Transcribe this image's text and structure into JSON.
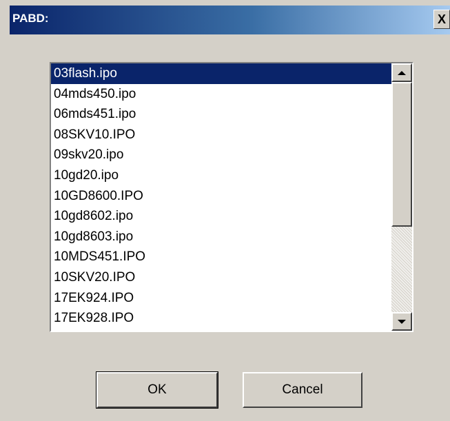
{
  "window": {
    "title": "PABD:",
    "close_label": "X"
  },
  "list": {
    "items": [
      "03flash.ipo",
      "04mds450.ipo",
      "06mds451.ipo",
      "08SKV10.IPO",
      "09skv20.ipo",
      "10gd20.ipo",
      "10GD8600.IPO",
      "10gd8602.ipo",
      "10gd8603.ipo",
      "10MDS451.IPO",
      "10SKV20.IPO",
      "17EK924.IPO",
      "17EK928.IPO"
    ],
    "selected_index": 0
  },
  "buttons": {
    "ok_label": "OK",
    "cancel_label": "Cancel"
  },
  "icons": {
    "scroll_up": "chevron-up-icon",
    "scroll_down": "chevron-down-icon",
    "close": "close-icon"
  },
  "colors": {
    "title_bar_start": "#0a246a",
    "title_bar_end": "#a6caf0",
    "selection": "#0a246a",
    "face": "#d4d0c8"
  }
}
